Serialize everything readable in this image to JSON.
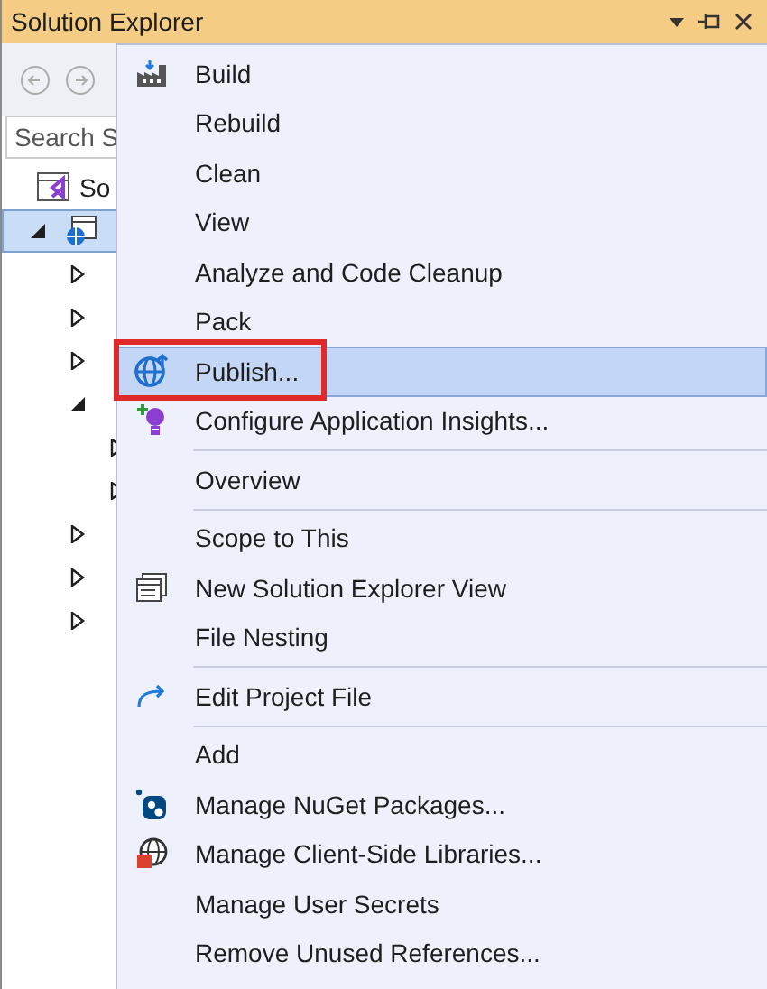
{
  "window": {
    "title": "Solution Explorer"
  },
  "search": {
    "placeholder": "Search S"
  },
  "tree": [
    {
      "label": "So",
      "selected": false
    },
    {
      "selected": true,
      "expanded": true,
      "children": [
        {
          "selected": false,
          "expanded": false
        },
        {
          "selected": false,
          "expanded": false
        },
        {
          "selected": false,
          "expanded": false
        },
        {
          "selected": false,
          "expanded": true,
          "children": [
            {
              "selected": false,
              "expanded": false
            },
            {
              "selected": false,
              "expanded": false
            }
          ]
        },
        {
          "selected": false,
          "expanded": false
        },
        {
          "selected": false,
          "expanded": false
        },
        {
          "selected": false,
          "expanded": false
        }
      ]
    }
  ],
  "menu": {
    "groups": [
      [
        {
          "label": "Build",
          "selected": false
        },
        {
          "label": "Rebuild",
          "selected": false
        },
        {
          "label": "Clean",
          "selected": false
        },
        {
          "label": "View",
          "selected": false
        },
        {
          "label": "Analyze and Code Cleanup",
          "selected": false
        },
        {
          "label": "Pack",
          "selected": false
        },
        {
          "label": "Publish...",
          "selected": true,
          "annotated": true
        },
        {
          "label": "Configure Application Insights...",
          "selected": false
        }
      ],
      [
        {
          "label": "Overview",
          "selected": false
        }
      ],
      [
        {
          "label": "Scope to This",
          "selected": false
        },
        {
          "label": "New Solution Explorer View",
          "selected": false
        },
        {
          "label": "File Nesting",
          "selected": false
        }
      ],
      [
        {
          "label": "Edit Project File",
          "selected": false
        }
      ],
      [
        {
          "label": "Add",
          "selected": false
        },
        {
          "label": "Manage NuGet Packages...",
          "selected": false
        },
        {
          "label": "Manage Client-Side Libraries...",
          "selected": false
        },
        {
          "label": "Manage User Secrets",
          "selected": false
        },
        {
          "label": "Remove Unused References...",
          "selected": false
        }
      ]
    ]
  }
}
